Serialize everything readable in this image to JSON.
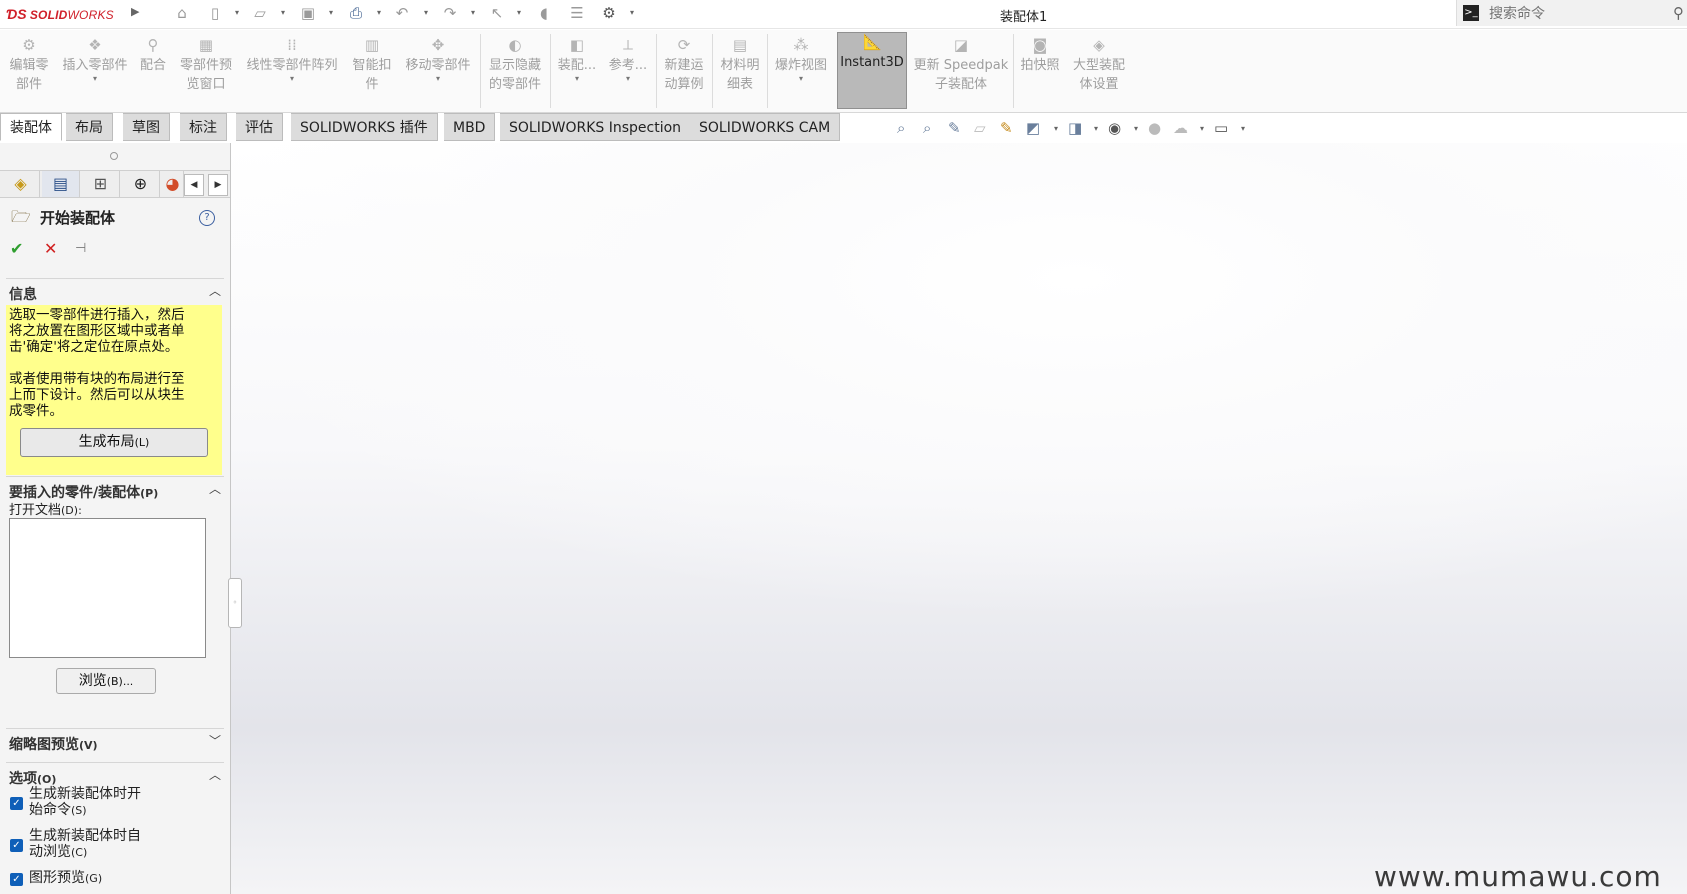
{
  "app": {
    "logo_text": "SOLIDWORKS",
    "window_title": "装配体1"
  },
  "quick_access": [
    "home-icon",
    "new-file-icon",
    "open-file-icon",
    "save-icon",
    "print-icon",
    "undo-icon",
    "redo-icon",
    "select-cursor-icon",
    "rebuild-icon",
    "file-properties-icon",
    "options-gear-icon"
  ],
  "search": {
    "placeholder": "搜索命令"
  },
  "toolbar": {
    "items": [
      {
        "label1": "编辑零",
        "label2": "部件",
        "icon": "edit-component-icon"
      },
      {
        "label1": "插入零部件",
        "label2": "",
        "icon": "insert-component-icon",
        "dropdown": true
      },
      {
        "label1": "配合",
        "label2": "",
        "icon": "mate-icon"
      },
      {
        "label1": "零部件预",
        "label2": "览窗口",
        "icon": "component-preview-icon"
      },
      {
        "label1": "线性零部件阵列",
        "label2": "",
        "icon": "linear-pattern-icon",
        "dropdown": true
      },
      {
        "label1": "智能扣",
        "label2": "件",
        "icon": "smart-fasteners-icon"
      },
      {
        "label1": "移动零部件",
        "label2": "",
        "icon": "move-component-icon",
        "dropdown": true
      },
      {
        "label1": "显示隐藏",
        "label2": "的零部件",
        "icon": "show-hidden-icon"
      },
      {
        "label1": "装配...",
        "label2": "",
        "icon": "assembly-features-icon",
        "dropdown": true
      },
      {
        "label1": "参考...",
        "label2": "",
        "icon": "reference-geometry-icon",
        "dropdown": true
      },
      {
        "label1": "新建运",
        "label2": "动算例",
        "icon": "motion-study-icon"
      },
      {
        "label1": "材料明",
        "label2": "细表",
        "icon": "bom-icon"
      },
      {
        "label1": "爆炸视图",
        "label2": "",
        "icon": "exploded-view-icon",
        "dropdown": true
      },
      {
        "label1": "Instant3D",
        "label2": "",
        "icon": "instant3d-icon"
      },
      {
        "label1": "更新 Speedpak",
        "label2": "子装配体",
        "icon": "speedpak-icon"
      },
      {
        "label1": "拍快照",
        "label2": "",
        "icon": "snapshot-icon"
      },
      {
        "label1": "大型装配",
        "label2": "体设置",
        "icon": "large-assembly-icon"
      }
    ]
  },
  "tabs": [
    "装配体",
    "布局",
    "草图",
    "标注",
    "评估",
    "SOLIDWORKS 插件",
    "MBD",
    "SOLIDWORKS Inspection",
    "SOLIDWORKS CAM"
  ],
  "view_toolbar": [
    "zoom-to-fit-icon",
    "zoom-to-area-icon",
    "previous-view-icon",
    "section-view-icon",
    "dynamic-annotation-icon",
    "view-orientation-icon",
    "display-style-icon",
    "hide-show-items-icon",
    "edit-appearance-icon",
    "apply-scene-icon",
    "view-settings-icon"
  ],
  "panel": {
    "title": "开始装配体",
    "info": {
      "title": "信息",
      "text1_l1": "选取一零部件进行插入，然后",
      "text1_l2": "将之放置在图形区域中或者单",
      "text1_l3": "击'确定'将之定位在原点处。",
      "text2_l1": "或者使用带有块的布局进行至",
      "text2_l2": "上而下设计。然后可以从块生",
      "text2_l3": "成零件。",
      "button": "生成布局",
      "button_hotkey": "(L)"
    },
    "insert": {
      "title": "要插入的零件/装配体",
      "title_hotkey": "(P)",
      "open_doc": "打开文档",
      "open_doc_hotkey": "(D):",
      "browse": "浏览",
      "browse_hotkey": "(B)..."
    },
    "thumb": {
      "title": "缩略图预览",
      "hotkey": "(V)"
    },
    "options": {
      "title": "选项",
      "hotkey": "(O)",
      "opt1_l1": "生成新装配体时开",
      "opt1_l2": "始命令",
      "opt1_hk": "(S)",
      "opt2_l1": "生成新装配体时自",
      "opt2_l2": "动浏览",
      "opt2_hk": "(C)",
      "opt3": "图形预览",
      "opt3_hk": "(G)"
    }
  },
  "watermark": "www.mumawu.com"
}
